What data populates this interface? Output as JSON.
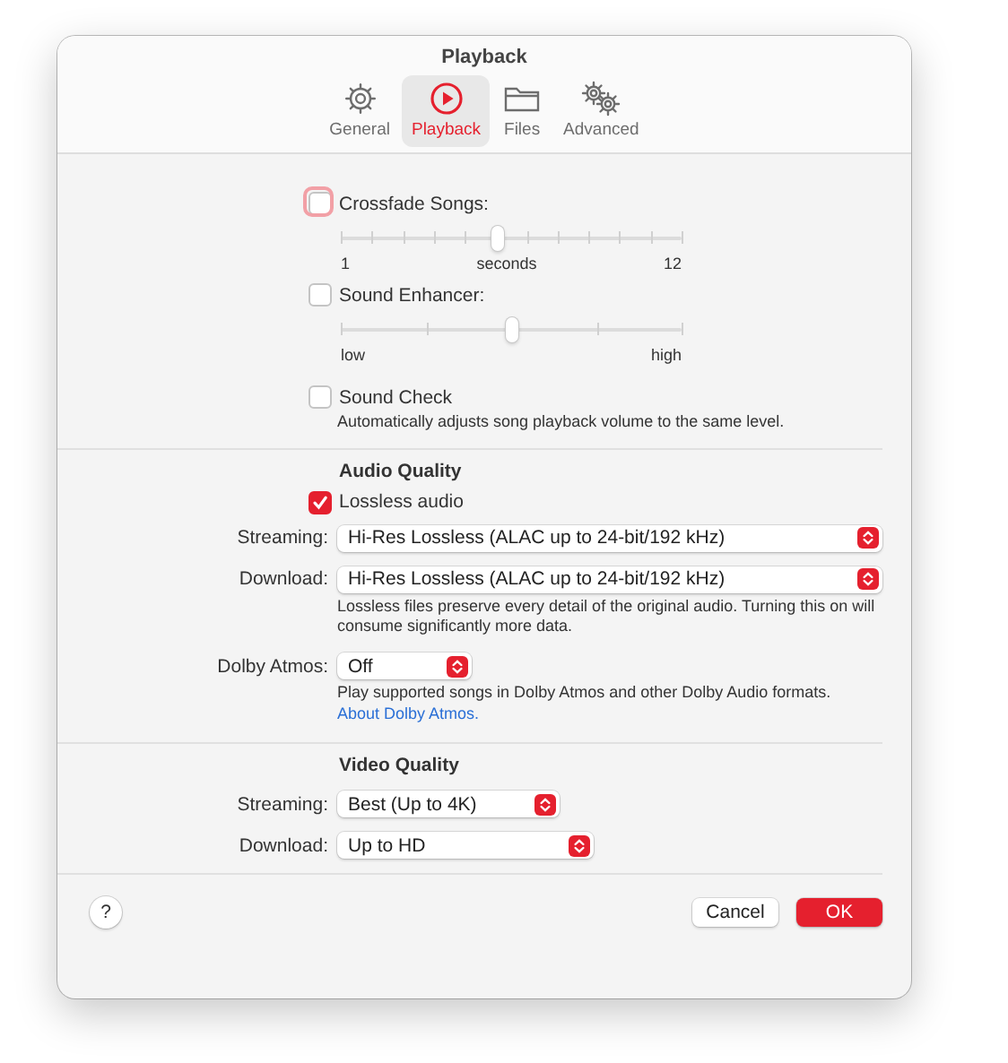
{
  "window": {
    "title": "Playback"
  },
  "tabs": [
    {
      "label": "General",
      "kind": "gear",
      "selected": false
    },
    {
      "label": "Playback",
      "kind": "play",
      "selected": true
    },
    {
      "label": "Files",
      "kind": "folder",
      "selected": false
    },
    {
      "label": "Advanced",
      "kind": "gears",
      "selected": false
    }
  ],
  "crossfade": {
    "label": "Crossfade Songs:",
    "checked": false,
    "focused": true,
    "kind": "seconds",
    "level": 0.46,
    "min_label": "1",
    "mid_label": "seconds",
    "max_label": "12"
  },
  "sound_enhancer": {
    "label": "Sound Enhancer:",
    "checked": false,
    "kind": "range",
    "level": 0.5,
    "min_label": "low",
    "max_label": "high"
  },
  "sound_check": {
    "label": "Sound Check",
    "checked": false,
    "note": "Automatically adjusts song playback volume to the same level."
  },
  "audio_quality": {
    "heading": "Audio Quality",
    "lossless": {
      "label": "Lossless audio",
      "checked": true
    },
    "rows": [
      {
        "label": "Streaming:",
        "value": "Hi-Res Lossless (ALAC up to 24-bit/192 kHz)"
      },
      {
        "label": "Download:",
        "value": "Hi-Res Lossless (ALAC up to 24-bit/192 kHz)",
        "note": "Lossless files preserve every detail of the original audio. Turning this on will consume significantly more data."
      },
      {
        "label": "Dolby Atmos:",
        "value": "Off",
        "note": "Play supported songs in Dolby Atmos and other Dolby Audio formats.",
        "link": "About Dolby Atmos."
      }
    ]
  },
  "video_quality": {
    "heading": "Video Quality",
    "rows": [
      {
        "label": "Streaming:",
        "value": "Best (Up to 4K)"
      },
      {
        "label": "Download:",
        "value": "Up to HD"
      }
    ]
  },
  "help": "?",
  "buttons": [
    {
      "label": "Cancel",
      "kind": "plain"
    },
    {
      "label": "OK",
      "kind": "default"
    }
  ]
}
